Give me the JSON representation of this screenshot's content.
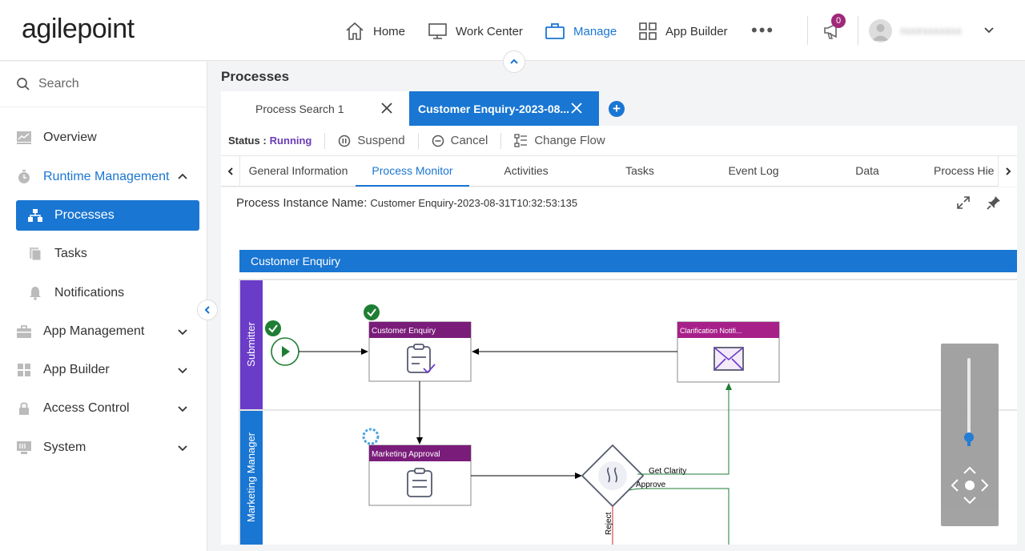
{
  "header": {
    "logo": "agilepoint",
    "nav": [
      {
        "label": "Home"
      },
      {
        "label": "Work Center"
      },
      {
        "label": "Manage"
      },
      {
        "label": "App Builder"
      }
    ],
    "more": "•••",
    "notification_count": "0",
    "username": "noorxxxxxxx"
  },
  "sidebar": {
    "search_placeholder": "Search",
    "items": [
      {
        "label": "Overview"
      },
      {
        "label": "Runtime Management"
      },
      {
        "label": "Processes"
      },
      {
        "label": "Tasks"
      },
      {
        "label": "Notifications"
      },
      {
        "label": "App Management"
      },
      {
        "label": "App Builder"
      },
      {
        "label": "Access Control"
      },
      {
        "label": "System"
      }
    ]
  },
  "main": {
    "title": "Processes",
    "tabs": [
      {
        "label": "Process Search 1"
      },
      {
        "label": "Customer Enquiry-2023-08..."
      }
    ],
    "status_label": "Status :",
    "status_value": "Running",
    "actions": {
      "suspend": "Suspend",
      "cancel": "Cancel",
      "change_flow": "Change Flow"
    },
    "subtabs": [
      "General Information",
      "Process Monitor",
      "Activities",
      "Tasks",
      "Event Log",
      "Data",
      "Process Hie"
    ],
    "instance_label": "Process Instance Name:",
    "instance_name": "Customer Enquiry-2023-08-31T10:32:53:135"
  },
  "diagram": {
    "pool": "Customer Enquiry",
    "lanes": [
      "Submitter",
      "Marketing Manager"
    ],
    "activities": {
      "customer_enquiry": "Customer Enquiry",
      "clarification": "Clarification Notifi...",
      "marketing_approval": "Marketing Approval"
    },
    "flows": {
      "get_clarity": "Get Clarity",
      "approve": "Approve",
      "reject": "Reject"
    },
    "colors": {
      "pool_header": "#1976d2",
      "lane": "#6a3cc8",
      "lane2": "#1976d2",
      "activity_header": "#7a1c7a",
      "notify_header": "#a7208a",
      "done": "#1e7e34"
    }
  },
  "zoom": {
    "level": 0.1
  }
}
